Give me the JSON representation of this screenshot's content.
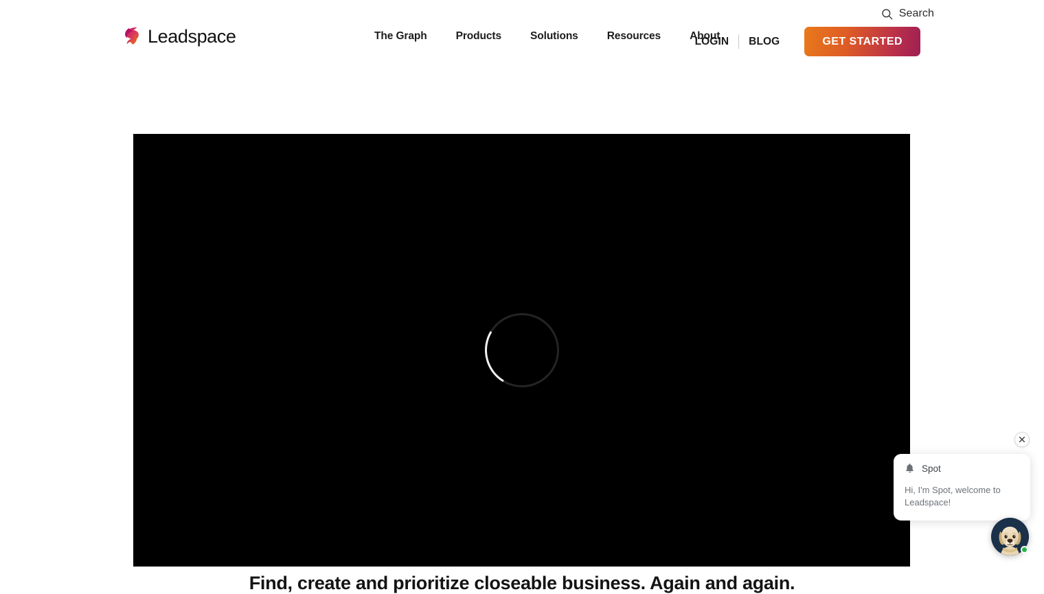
{
  "utility": {
    "search_label": "Search",
    "search_icon": "search-icon"
  },
  "brand": {
    "name": "Leadspace",
    "mark_icon": "leadspace-logo-mark"
  },
  "nav": {
    "items": [
      {
        "label": "The Graph"
      },
      {
        "label": "Products"
      },
      {
        "label": "Solutions"
      },
      {
        "label": "Resources"
      },
      {
        "label": "About"
      }
    ]
  },
  "header_right": {
    "login_label": "LOGIN",
    "blog_label": "BLOG",
    "cta_label": "GET STARTED",
    "cta_gradient_start": "#e87a1b",
    "cta_gradient_end": "#9e1f53"
  },
  "hero": {
    "video_state": "loading",
    "spinner_icon": "loading-spinner-icon",
    "background_color": "#000000",
    "headline": "Find, create and prioritize closeable business. Again and again."
  },
  "chat": {
    "close_icon": "close-icon",
    "bell_icon": "bell-icon",
    "bot_name": "Spot",
    "message": "Hi, I'm Spot, welcome to Leadspace!",
    "avatar_icon": "dog-avatar-icon",
    "status_color": "#27b34a"
  }
}
